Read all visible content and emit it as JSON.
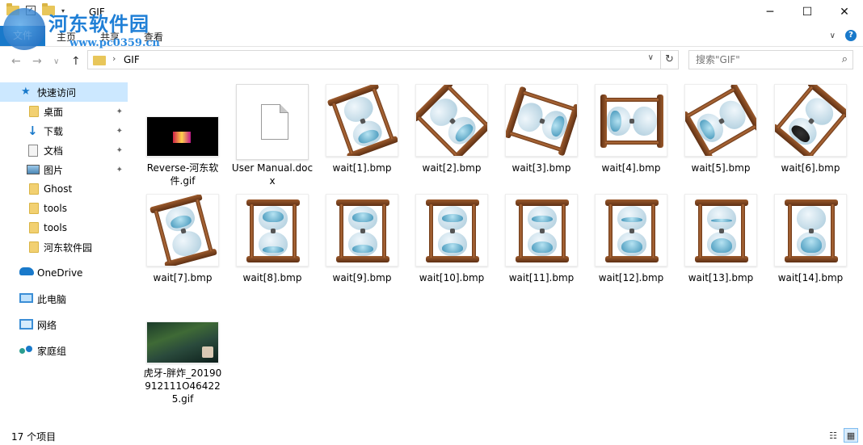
{
  "window": {
    "title": "GIF",
    "qat_check": "✓",
    "dropdown": "▾",
    "minimize": "─",
    "maximize": "☐",
    "close": "✕"
  },
  "watermark": {
    "text": "河东软件园",
    "url": "www.pc0359.cn"
  },
  "ribbon": {
    "file_tab": "文件",
    "tabs": [
      "主页",
      "共享",
      "查看"
    ],
    "collapse_chevron": "∨",
    "help": "?"
  },
  "navbar": {
    "back": "←",
    "forward": "→",
    "recent": "∨",
    "up": "↑",
    "separator": "›",
    "crumb": "GIF",
    "dropdown": "∨",
    "refresh": "↻",
    "search_placeholder": "搜索\"GIF\"",
    "search_icon": "⌕"
  },
  "sidebar": {
    "quick_access": "快速访问",
    "items": [
      {
        "label": "桌面",
        "pinned": true
      },
      {
        "label": "下载",
        "pinned": true
      },
      {
        "label": "文档",
        "pinned": true
      },
      {
        "label": "图片",
        "pinned": true
      },
      {
        "label": "Ghost",
        "pinned": false
      },
      {
        "label": "tools",
        "pinned": false
      },
      {
        "label": "tools",
        "pinned": false
      },
      {
        "label": "河东软件园",
        "pinned": false
      }
    ],
    "pin_glyph": "📌",
    "onedrive": "OneDrive",
    "this_pc": "此电脑",
    "network": "网络",
    "homegroup": "家庭组"
  },
  "files": [
    {
      "name": "Reverse-河东软件.gif",
      "kind": "gif1"
    },
    {
      "name": "User Manual.docx",
      "kind": "docx"
    },
    {
      "name": "wait[1].bmp",
      "kind": "hourglass"
    },
    {
      "name": "wait[2].bmp",
      "kind": "hourglass"
    },
    {
      "name": "wait[3].bmp",
      "kind": "hourglass"
    },
    {
      "name": "wait[4].bmp",
      "kind": "hourglass"
    },
    {
      "name": "wait[5].bmp",
      "kind": "hourglass"
    },
    {
      "name": "wait[6].bmp",
      "kind": "hourglass"
    },
    {
      "name": "wait[7].bmp",
      "kind": "hourglass"
    },
    {
      "name": "wait[8].bmp",
      "kind": "hourglass"
    },
    {
      "name": "wait[9].bmp",
      "kind": "hourglass"
    },
    {
      "name": "wait[10].bmp",
      "kind": "hourglass"
    },
    {
      "name": "wait[11].bmp",
      "kind": "hourglass"
    },
    {
      "name": "wait[12].bmp",
      "kind": "hourglass"
    },
    {
      "name": "wait[13].bmp",
      "kind": "hourglass"
    },
    {
      "name": "wait[14].bmp",
      "kind": "hourglass"
    },
    {
      "name": "虎牙-胖炸_20190912111O464225.gif",
      "kind": "gif2"
    }
  ],
  "status": {
    "count": "17 个项目",
    "details_view": "☷",
    "tiles_view": "▦"
  }
}
